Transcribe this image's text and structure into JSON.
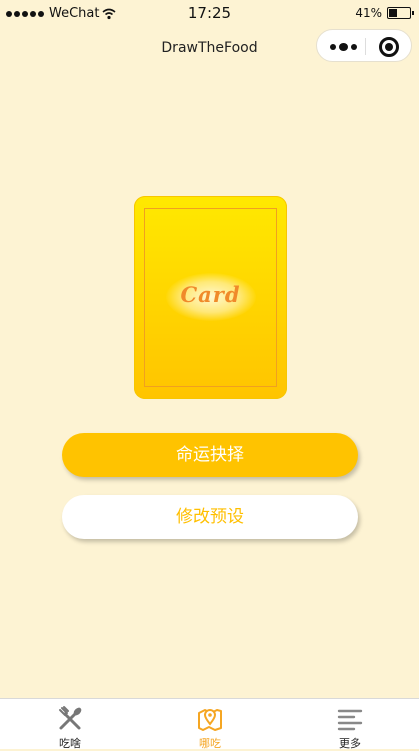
{
  "status_bar": {
    "carrier": "WeChat",
    "time": "17:25",
    "battery": "41%",
    "battery_level": 0.41
  },
  "nav": {
    "title": "DrawTheFood"
  },
  "card": {
    "label": "Card"
  },
  "actions": {
    "primary_label": "命运抉择",
    "secondary_label": "修改预设"
  },
  "tabbar": {
    "items": [
      {
        "label": "吃啥",
        "icon": "fork-spoon-icon",
        "active": false
      },
      {
        "label": "哪吃",
        "icon": "map-pin-icon",
        "active": true
      },
      {
        "label": "更多",
        "icon": "menu-lines-icon",
        "active": false
      }
    ]
  },
  "colors": {
    "background": "#fdf3d3",
    "accent": "#ffc300",
    "active_tab": "#f5a623"
  }
}
